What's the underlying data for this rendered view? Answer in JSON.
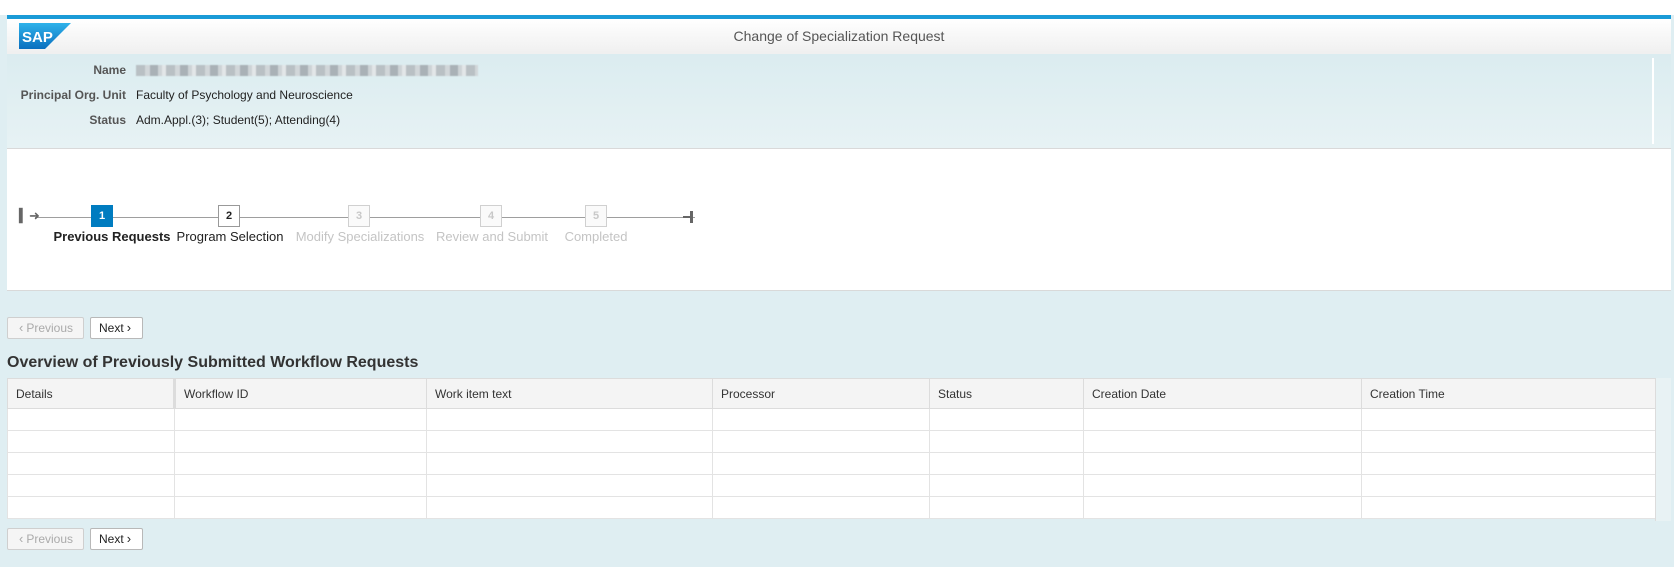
{
  "shell": {
    "title": "Change of Specialization Request",
    "logo": "SAP"
  },
  "header": {
    "fields": [
      {
        "label": "Name",
        "value": ""
      },
      {
        "label": "Principal Org. Unit",
        "value": "Faculty of Psychology and Neuroscience"
      },
      {
        "label": "Status",
        "value": "Adm.Appl.(3); Student(5); Attending(4)"
      }
    ]
  },
  "roadmap": {
    "steps": [
      {
        "number": "1",
        "label": "Previous Requests",
        "state": "active"
      },
      {
        "number": "2",
        "label": "Program Selection",
        "state": "enabled"
      },
      {
        "number": "3",
        "label": "Modify Specializations",
        "state": "disabled"
      },
      {
        "number": "4",
        "label": "Review and Submit",
        "state": "disabled"
      },
      {
        "number": "5",
        "label": "Completed",
        "state": "disabled"
      }
    ]
  },
  "nav": {
    "previous_label": "Previous",
    "next_label": "Next"
  },
  "section": {
    "title": "Overview of Previously Submitted Workflow Requests"
  },
  "table": {
    "columns": [
      "Details",
      "Workflow ID",
      "Work item text",
      "Processor",
      "Status",
      "Creation Date",
      "Creation Time"
    ],
    "rows": [
      [
        "",
        "",
        "",
        "",
        "",
        "",
        ""
      ],
      [
        "",
        "",
        "",
        "",
        "",
        "",
        ""
      ],
      [
        "",
        "",
        "",
        "",
        "",
        "",
        ""
      ],
      [
        "",
        "",
        "",
        "",
        "",
        "",
        ""
      ],
      [
        "",
        "",
        "",
        "",
        "",
        "",
        ""
      ]
    ]
  },
  "colors": {
    "accent": "#1a9bd7",
    "active_step": "#007cc0",
    "background": "#dfeef2"
  }
}
